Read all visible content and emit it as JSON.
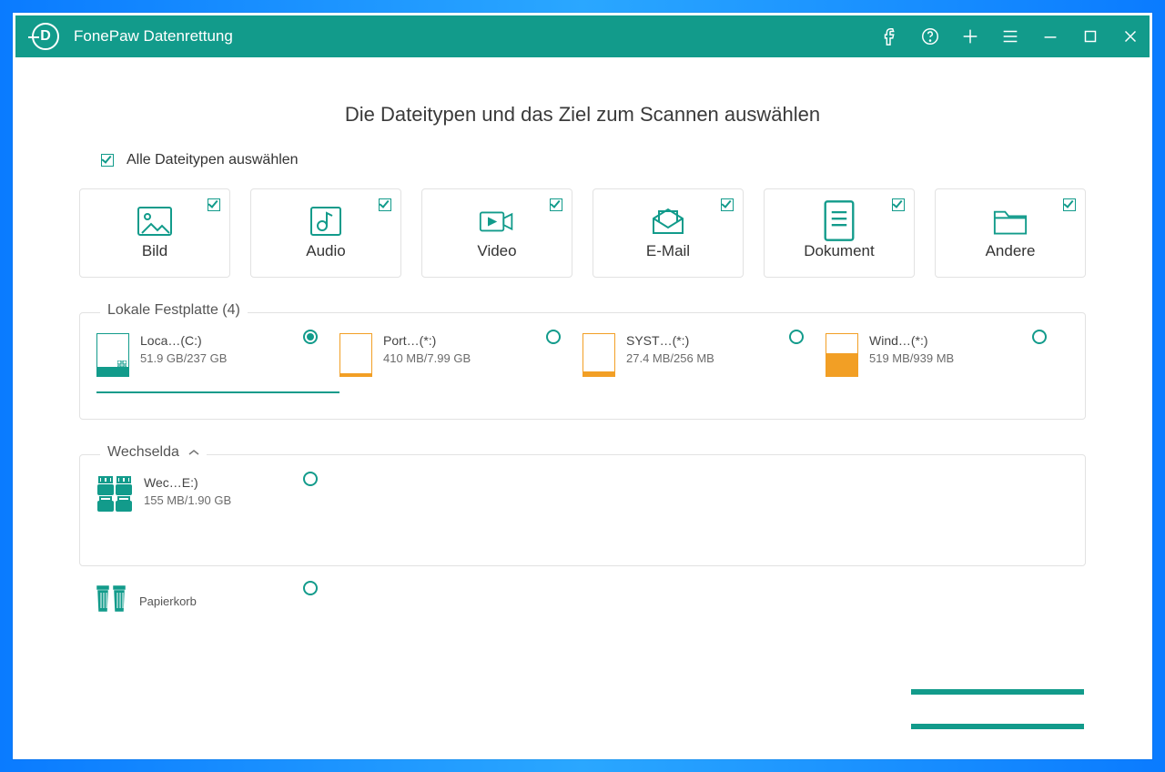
{
  "header": {
    "app_title": "FonePaw Datenrettung"
  },
  "main": {
    "headline": "Die Dateitypen und das Ziel zum Scannen auswählen",
    "select_all_label": "Alle Dateitypen auswählen",
    "types": [
      {
        "label": "Bild"
      },
      {
        "label": "Audio"
      },
      {
        "label": "Video"
      },
      {
        "label": "E-Mail"
      },
      {
        "label": "Dokument"
      },
      {
        "label": "Andere"
      }
    ],
    "local_group_label": "Lokale Festplatte (4)",
    "local_disks": [
      {
        "name": "Loca…(C:)",
        "size": "51.9 GB/237 GB",
        "fill_pct": 22,
        "color": "#129b8b",
        "selected": true,
        "windows": true
      },
      {
        "name": "Port…(*:)",
        "size": "410 MB/7.99 GB",
        "fill_pct": 6,
        "color": "#f29f25",
        "selected": false,
        "windows": false
      },
      {
        "name": "SYST…(*:)",
        "size": "27.4 MB/256 MB",
        "fill_pct": 11,
        "color": "#f29f25",
        "selected": false,
        "windows": false
      },
      {
        "name": "Wind…(*:)",
        "size": "519 MB/939 MB",
        "fill_pct": 55,
        "color": "#f29f25",
        "selected": false,
        "windows": false
      }
    ],
    "removable_group_label": "Wechselda",
    "removable_disks": [
      {
        "name": "Wec…E:)",
        "size": "155 MB/1.90 GB"
      }
    ],
    "bin_label": "Papierkorb"
  }
}
